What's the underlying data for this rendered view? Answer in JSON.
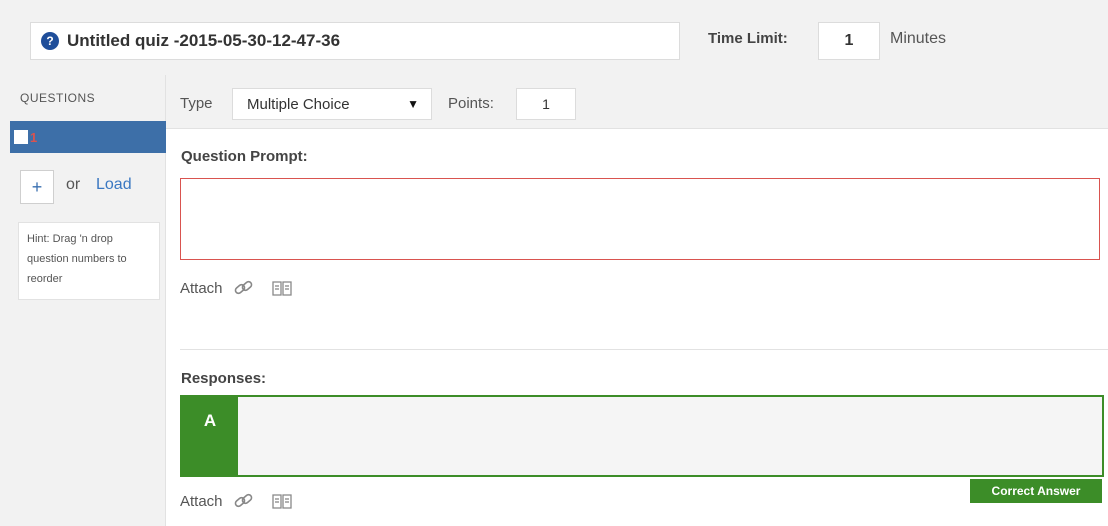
{
  "header": {
    "quiz_icon": "?",
    "quiz_title": "Untitled quiz -2015-05-30-12-47-36",
    "time_limit_label": "Time Limit:",
    "time_limit_value": "1",
    "minutes_label": "Minutes"
  },
  "sidebar": {
    "questions_header": "QUESTIONS",
    "question_items": [
      {
        "number": "1"
      }
    ],
    "add_symbol": "+",
    "or_text": "or",
    "load_link": "Load",
    "hint": "Hint: Drag 'n drop question numbers to reorder"
  },
  "toolbar": {
    "type_label": "Type",
    "type_value": "Multiple Choice",
    "points_label": "Points:",
    "points_value": "1"
  },
  "prompt": {
    "title": "Question Prompt:",
    "attach_label": "Attach"
  },
  "responses": {
    "title": "Responses:",
    "items": [
      {
        "letter": "A",
        "text": ""
      }
    ],
    "attach_label": "Attach",
    "correct_answer_label": "Correct Answer"
  },
  "icons": {
    "quiz": "question-circle-icon",
    "attach_link": "link-icon",
    "attach_media": "book-icon",
    "dropdown": "caret-down-icon"
  },
  "colors": {
    "accent_blue": "#3d6fa8",
    "link_blue": "#3a78c2",
    "correct_green": "#3c8d28",
    "error_red": "#d9534f"
  }
}
